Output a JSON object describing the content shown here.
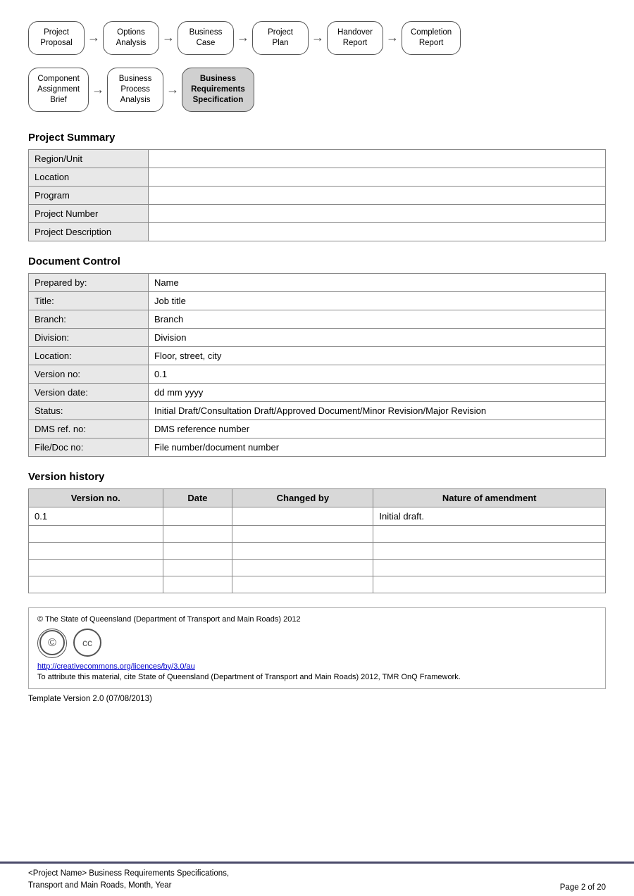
{
  "flow1": {
    "nodes": [
      {
        "label": "Project\nProposal",
        "active": false
      },
      {
        "label": "Options\nAnalysis",
        "active": false
      },
      {
        "label": "Business\nCase",
        "active": false
      },
      {
        "label": "Project\nPlan",
        "active": false
      },
      {
        "label": "Handover\nReport",
        "active": false
      },
      {
        "label": "Completion\nReport",
        "active": false
      }
    ]
  },
  "flow2": {
    "nodes": [
      {
        "label": "Component\nAssignment\nBrief",
        "active": false
      },
      {
        "label": "Business\nProcess\nAnalysis",
        "active": false
      },
      {
        "label": "Business\nRequirements\nSpecification",
        "active": true
      }
    ]
  },
  "project_summary": {
    "title": "Project Summary",
    "rows": [
      {
        "label": "Region/Unit",
        "value": ""
      },
      {
        "label": "Location",
        "value": ""
      },
      {
        "label": "Program",
        "value": ""
      },
      {
        "label": "Project Number",
        "value": ""
      },
      {
        "label": "Project Description",
        "value": ""
      }
    ]
  },
  "document_control": {
    "title": "Document Control",
    "rows": [
      {
        "label": "Prepared by:",
        "value": "Name"
      },
      {
        "label": "Title:",
        "value": "Job title"
      },
      {
        "label": "Branch:",
        "value": "Branch"
      },
      {
        "label": "Division:",
        "value": "Division"
      },
      {
        "label": "Location:",
        "value": "Floor, street, city"
      },
      {
        "label": "Version no:",
        "value": "0.1"
      },
      {
        "label": "Version date:",
        "value": "dd mm yyyy"
      },
      {
        "label": "Status:",
        "value": "Initial Draft/Consultation Draft/Approved Document/Minor Revision/Major Revision"
      },
      {
        "label": "DMS ref. no:",
        "value": "DMS reference number"
      },
      {
        "label": "File/Doc no:",
        "value": "File number/document number"
      }
    ]
  },
  "version_history": {
    "title": "Version history",
    "columns": [
      "Version no.",
      "Date",
      "Changed by",
      "Nature of amendment"
    ],
    "rows": [
      {
        "version": "0.1",
        "date": "",
        "changed_by": "",
        "nature": "Initial draft."
      },
      {
        "version": "",
        "date": "",
        "changed_by": "",
        "nature": ""
      },
      {
        "version": "",
        "date": "",
        "changed_by": "",
        "nature": ""
      },
      {
        "version": "",
        "date": "",
        "changed_by": "",
        "nature": ""
      },
      {
        "version": "",
        "date": "",
        "changed_by": "",
        "nature": ""
      }
    ]
  },
  "copyright": {
    "line1": "© The State of Queensland (Department of Transport and Main Roads) 2012",
    "link": "http://creativecommons.org/licences/by/3.0/au",
    "attribution": "To attribute this material, cite State of Queensland (Department of Transport and Main Roads) 2012, TMR OnQ Framework."
  },
  "template_version": "Template Version 2.0 (07/08/2013)",
  "footer": {
    "left_line1": "<Project Name> Business Requirements Specifications,",
    "left_line2": "Transport and Main Roads, Month, Year",
    "right": "Page 2 of 20"
  }
}
